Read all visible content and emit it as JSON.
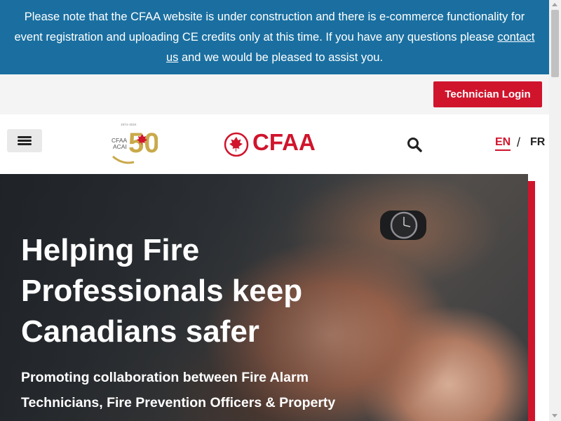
{
  "notice": {
    "text_before": "Please note that the CFAA website is under construction and there is e-commerce functionality for event registration and uploading CE credits only at this time. If you have any questions please ",
    "link_text": "contact us",
    "text_after": " and we would be pleased to assist you."
  },
  "utility_bar": {
    "technician_login": "Technician Login"
  },
  "header": {
    "anniversary_logo": {
      "years": "1974–2024",
      "line1": "CFAA",
      "line2": "ACAI",
      "number": "50"
    },
    "brand_logo_text": "CFAA",
    "languages": {
      "en": "EN",
      "separator": "/",
      "fr": "FR"
    },
    "icons": {
      "menu": "hamburger-menu-icon",
      "search": "search-icon"
    }
  },
  "hero": {
    "title": "Helping Fire Professionals keep Canadians safer",
    "subtitle": "Promoting collaboration between Fire Alarm Technicians, Fire Prevention Officers & Property"
  },
  "colors": {
    "notice_bg": "#1a6fa0",
    "brand_red": "#d0142c",
    "utility_bg": "#f4f4f4"
  }
}
